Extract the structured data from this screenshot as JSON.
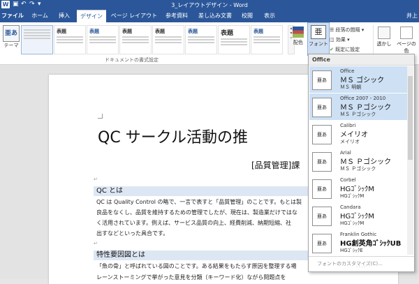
{
  "window": {
    "title": "3_レイアウトデザイン - Word",
    "qat": [
      "↶",
      "↷",
      "▾"
    ]
  },
  "tabs": [
    "ファイル",
    "ホーム",
    "挿入",
    "デザイン",
    "ページ レイアウト",
    "参考資料",
    "差し込み文書",
    "校閲",
    "表示"
  ],
  "user": "井上",
  "ribbon": {
    "theme_label": "テーマ",
    "theme_icon": "亜あ",
    "gallery_headings": [
      "",
      "表題",
      "表題",
      "表題",
      "表題",
      "表題",
      "表題",
      "表題"
    ],
    "gallery_group_label": "ドキュメントの書式設定",
    "color_label": "配色",
    "font_label": "フォント",
    "font_icon": "亜",
    "para_spacing": "段落の間隔",
    "effects": "効果",
    "set_default": "既定に設定",
    "watermark": "透かし",
    "page_color": "ページの色"
  },
  "document": {
    "title": "QC サークル活動の推",
    "subtitle": "[品質管理]課",
    "heading1": "QC とは",
    "body1": [
      "QC は Quality Control の略で、一言で表すと「品質管理」のことです。もとは製",
      "良品をなくし、品質を維持するための管理でしたが、現在は、製造業だけではな",
      "く活用されています。例えば、サービス品質の向上、経費削減、納期短縮、社",
      "出すなどといった具合です。"
    ],
    "heading2": "特性要因図とは",
    "body2": [
      "「魚の骨」と呼ばれている図のことです。ある結果をもたらす原因を整理する場",
      "レーンストーミングで挙がった意見を分類（キーワード化）ながら問題点を"
    ]
  },
  "font_dropdown": {
    "header": "Office",
    "items": [
      {
        "name": "Office",
        "heading_font": "ＭＳ ゴシック",
        "body_font": "ＭＳ 明朝"
      },
      {
        "name": "Office 2007 - 2010",
        "heading_font": "ＭＳ Ｐゴシック",
        "body_font": "ＭＳ Ｐゴシック"
      },
      {
        "name": "Calibri",
        "heading_font": "メイリオ",
        "body_font": "メイリオ"
      },
      {
        "name": "Arial",
        "heading_font": "ＭＳ Ｐゴシック",
        "body_font": "ＭＳ Ｐゴシック"
      },
      {
        "name": "Corbel",
        "heading_font": "HGｺﾞｼｯｸM",
        "body_font": "HGｺﾞｼｯｸM"
      },
      {
        "name": "Candara",
        "heading_font": "HGｺﾞｼｯｸM",
        "body_font": "HGｺﾞｼｯｸM"
      },
      {
        "name": "Franklin Gothic",
        "heading_font": "HG創英角ｺﾞｼｯｸUB",
        "body_font": "HGｺﾞｼｯｸE"
      }
    ],
    "preview_text": "亜あ",
    "footer": "フォントのカスタマイズ(C)..."
  },
  "colors": {
    "accent": "#2b579a",
    "highlight": "#cde0f4",
    "heading_shade": "#dde7f4"
  }
}
